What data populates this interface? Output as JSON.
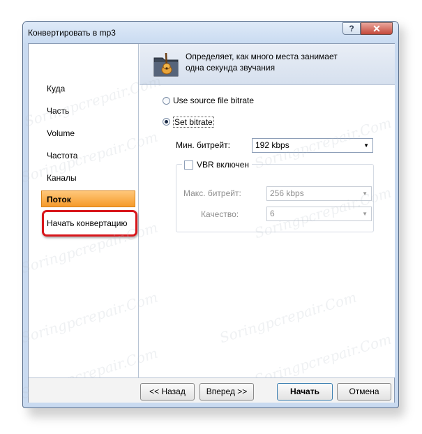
{
  "window": {
    "title": "Конвертировать в mp3",
    "help_icon": "?",
    "close_icon": "✕"
  },
  "nav": {
    "items": [
      {
        "label": "Куда"
      },
      {
        "label": "Часть"
      },
      {
        "label": "Volume"
      },
      {
        "label": "Частота"
      },
      {
        "label": "Каналы"
      },
      {
        "label": "Поток"
      },
      {
        "label": "Начать конвертацию"
      }
    ],
    "active_index": 5,
    "highlighted_index": 6
  },
  "header": {
    "description_line1": "Определяет, как много места занимает",
    "description_line2": "одна секунда звучания",
    "icon": "folder-guitar-icon"
  },
  "bitrate": {
    "option_source": "Use source file bitrate",
    "option_set": "Set bitrate",
    "selected_option": "Set bitrate",
    "min_label": "Мин. битрейт:",
    "min_value": "192 kbps",
    "vbr_label": "VBR включен",
    "vbr_checked": false,
    "max_label": "Макс. битрейт:",
    "max_value": "256 kbps",
    "quality_label": "Качество:",
    "quality_value": "6"
  },
  "buttons": {
    "back": "<< Назад",
    "next": "Вперед >>",
    "start": "Начать",
    "cancel": "Отмена"
  },
  "watermark": "Soringpcrepair.Com",
  "colors": {
    "active_tab": "#f59a2a",
    "highlight_border": "#d8161b",
    "title_bar": "#c9daf0"
  }
}
